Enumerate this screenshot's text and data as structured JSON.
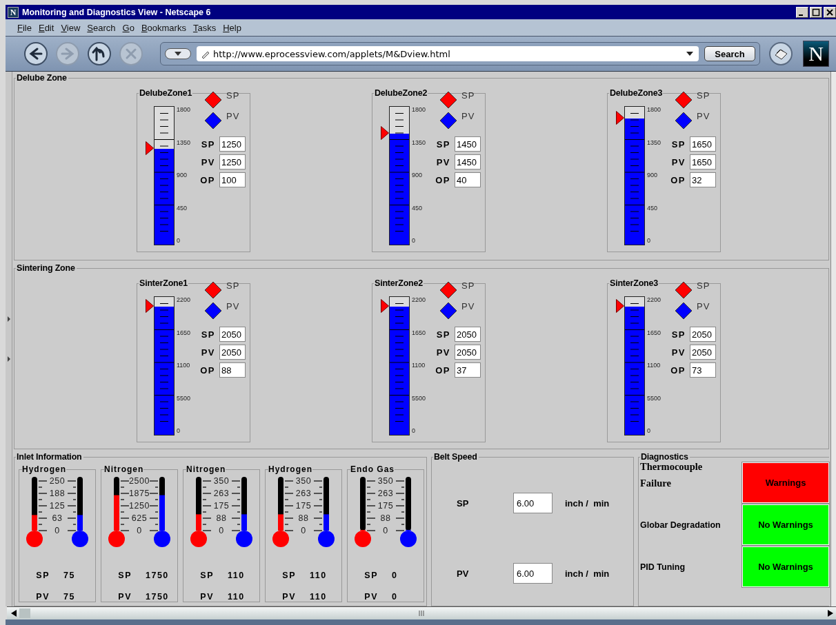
{
  "window": {
    "app_icon": "N",
    "title": "Monitoring and Diagnostics View - Netscape 6"
  },
  "menu": [
    "File",
    "Edit",
    "View",
    "Search",
    "Go",
    "Bookmarks",
    "Tasks",
    "Help"
  ],
  "toolbar": {
    "nav_buttons": [
      {
        "kind": "back",
        "disabled": false
      },
      {
        "kind": "forward",
        "disabled": true
      },
      {
        "kind": "reload",
        "disabled": false
      },
      {
        "kind": "stop",
        "disabled": true
      }
    ],
    "url": "http://www.eprocessview.com/applets/M&Dview.html",
    "search_button": "Search",
    "logo": "N"
  },
  "zone_groups": [
    {
      "title": "Delube Zone",
      "gauges": [
        {
          "title": "DelubeZone1",
          "scale": [
            "1800",
            "1350",
            "900",
            "450",
            "0"
          ],
          "bar": {
            "level": 0.694
          },
          "legend": [
            {
              "label": "SP",
              "color": "#ff0000"
            },
            {
              "label": "PV",
              "color": "#0000ff"
            }
          ],
          "fields": [
            {
              "label": "SP",
              "value": "1250"
            },
            {
              "label": "PV",
              "value": "1250"
            },
            {
              "label": "OP",
              "value": "100"
            }
          ]
        },
        {
          "title": "DelubeZone2",
          "scale": [
            "1800",
            "1350",
            "900",
            "450",
            "0"
          ],
          "bar": {
            "level": 0.806
          },
          "legend": [
            {
              "label": "SP",
              "color": "#ff0000"
            },
            {
              "label": "PV",
              "color": "#0000ff"
            }
          ],
          "fields": [
            {
              "label": "SP",
              "value": "1450"
            },
            {
              "label": "PV",
              "value": "1450"
            },
            {
              "label": "OP",
              "value": "40"
            }
          ]
        },
        {
          "title": "DelubeZone3",
          "scale": [
            "1800",
            "1350",
            "900",
            "450",
            "0"
          ],
          "bar": {
            "level": 0.917
          },
          "legend": [
            {
              "label": "SP",
              "color": "#ff0000"
            },
            {
              "label": "PV",
              "color": "#0000ff"
            }
          ],
          "fields": [
            {
              "label": "SP",
              "value": "1650"
            },
            {
              "label": "PV",
              "value": "1650"
            },
            {
              "label": "OP",
              "value": "32"
            }
          ]
        }
      ]
    },
    {
      "title": "Sintering Zone",
      "gauges": [
        {
          "title": "SinterZone1",
          "scale": [
            "2200",
            "1650",
            "1100",
            "5500",
            "0"
          ],
          "bar": {
            "level": 0.932
          },
          "legend": [
            {
              "label": "SP",
              "color": "#ff0000"
            },
            {
              "label": "PV",
              "color": "#0000ff"
            }
          ],
          "fields": [
            {
              "label": "SP",
              "value": "2050"
            },
            {
              "label": "PV",
              "value": "2050"
            },
            {
              "label": "OP",
              "value": "88"
            }
          ]
        },
        {
          "title": "SinterZone2",
          "scale": [
            "2200",
            "1650",
            "1100",
            "5500",
            "0"
          ],
          "bar": {
            "level": 0.932
          },
          "legend": [
            {
              "label": "SP",
              "color": "#ff0000"
            },
            {
              "label": "PV",
              "color": "#0000ff"
            }
          ],
          "fields": [
            {
              "label": "SP",
              "value": "2050"
            },
            {
              "label": "PV",
              "value": "2050"
            },
            {
              "label": "OP",
              "value": "37"
            }
          ]
        },
        {
          "title": "SinterZone3",
          "scale": [
            "2200",
            "1650",
            "1100",
            "5500",
            "0"
          ],
          "bar": {
            "level": 0.932
          },
          "legend": [
            {
              "label": "SP",
              "color": "#ff0000"
            },
            {
              "label": "PV",
              "color": "#0000ff"
            }
          ],
          "fields": [
            {
              "label": "SP",
              "value": "2050"
            },
            {
              "label": "PV",
              "value": "2050"
            },
            {
              "label": "OP",
              "value": "73"
            }
          ]
        }
      ]
    }
  ],
  "inlet": {
    "title": "Inlet Information",
    "gases": [
      {
        "title": "Hydrogen",
        "scale": [
          "250",
          "188",
          "125",
          "63",
          "0"
        ],
        "readings": [
          {
            "label": "SP",
            "value": "75",
            "level": 0.3,
            "color": "#ff0000"
          },
          {
            "label": "PV",
            "value": "75",
            "level": 0.3,
            "color": "#0000ff"
          }
        ]
      },
      {
        "title": "Nitrogen",
        "scale": [
          "2500",
          "1875",
          "1250",
          "625",
          "0"
        ],
        "readings": [
          {
            "label": "SP",
            "value": "1750",
            "level": 0.7,
            "color": "#ff0000"
          },
          {
            "label": "PV",
            "value": "1750",
            "level": 0.7,
            "color": "#0000ff"
          }
        ]
      },
      {
        "title": "Nitrogen",
        "scale": [
          "350",
          "263",
          "175",
          "88",
          "0"
        ],
        "readings": [
          {
            "label": "SP",
            "value": "110",
            "level": 0.314,
            "color": "#ff0000"
          },
          {
            "label": "PV",
            "value": "110",
            "level": 0.314,
            "color": "#0000ff"
          }
        ]
      },
      {
        "title": "Hydrogen",
        "scale": [
          "350",
          "263",
          "175",
          "88",
          "0"
        ],
        "readings": [
          {
            "label": "SP",
            "value": "110",
            "level": 0.314,
            "color": "#ff0000"
          },
          {
            "label": "PV",
            "value": "110",
            "level": 0.314,
            "color": "#0000ff"
          }
        ]
      },
      {
        "title": "Endo Gas",
        "scale": [
          "350",
          "263",
          "175",
          "88",
          "0"
        ],
        "readings": [
          {
            "label": "SP",
            "value": "0",
            "level": 0,
            "color": "#ff0000"
          },
          {
            "label": "PV",
            "value": "0",
            "level": 0,
            "color": "#0000ff"
          }
        ]
      }
    ]
  },
  "belt_speed": {
    "title": "Belt Speed",
    "rows": [
      {
        "label": "SP",
        "value": "6.00",
        "unit": "inch /  min"
      },
      {
        "label": "PV",
        "value": "6.00",
        "unit": "inch /  min"
      }
    ]
  },
  "diagnostics": {
    "title": "Diagnostics",
    "rows": [
      {
        "label": "Thermocouple Failure",
        "status": "Warnings",
        "color": "#ff0000"
      },
      {
        "label": "Globar Degradation",
        "status": "No Warnings",
        "color": "#00ff00"
      },
      {
        "label": "PID Tuning",
        "status": "No Warnings",
        "color": "#00ff00"
      }
    ]
  }
}
